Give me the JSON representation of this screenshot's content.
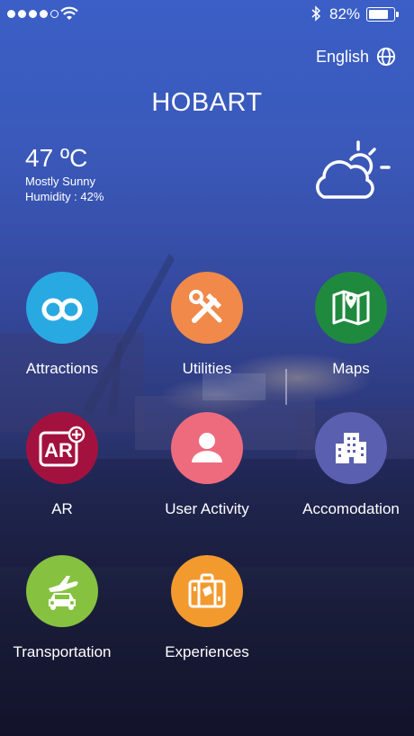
{
  "status": {
    "signal_bars": 4,
    "signal_total": 5,
    "battery_percent": "82%",
    "battery_level": 0.82
  },
  "header": {
    "language": "English",
    "city": "HOBART"
  },
  "weather": {
    "temperature": "47 ºC",
    "condition": "Mostly Sunny",
    "humidity": "Humidity : 42%",
    "icon": "partly-cloudy-icon"
  },
  "menu": [
    {
      "label": "Attractions",
      "icon": "binoculars-icon",
      "color": "#29a9e1"
    },
    {
      "label": "Utilities",
      "icon": "tools-icon",
      "color": "#f0894a"
    },
    {
      "label": "Maps",
      "icon": "map-pin-icon",
      "color": "#1f8a3e"
    },
    {
      "label": "AR",
      "icon": "ar-icon",
      "color": "#a3123f"
    },
    {
      "label": "User Activity",
      "icon": "user-icon",
      "color": "#ee6b7e"
    },
    {
      "label": "Accomodation",
      "icon": "building-icon",
      "color": "#5b5fb0"
    },
    {
      "label": "Transportation",
      "icon": "plane-car-icon",
      "color": "#86c240"
    },
    {
      "label": "Experiences",
      "icon": "suitcase-icon",
      "color": "#f29a2e"
    }
  ]
}
